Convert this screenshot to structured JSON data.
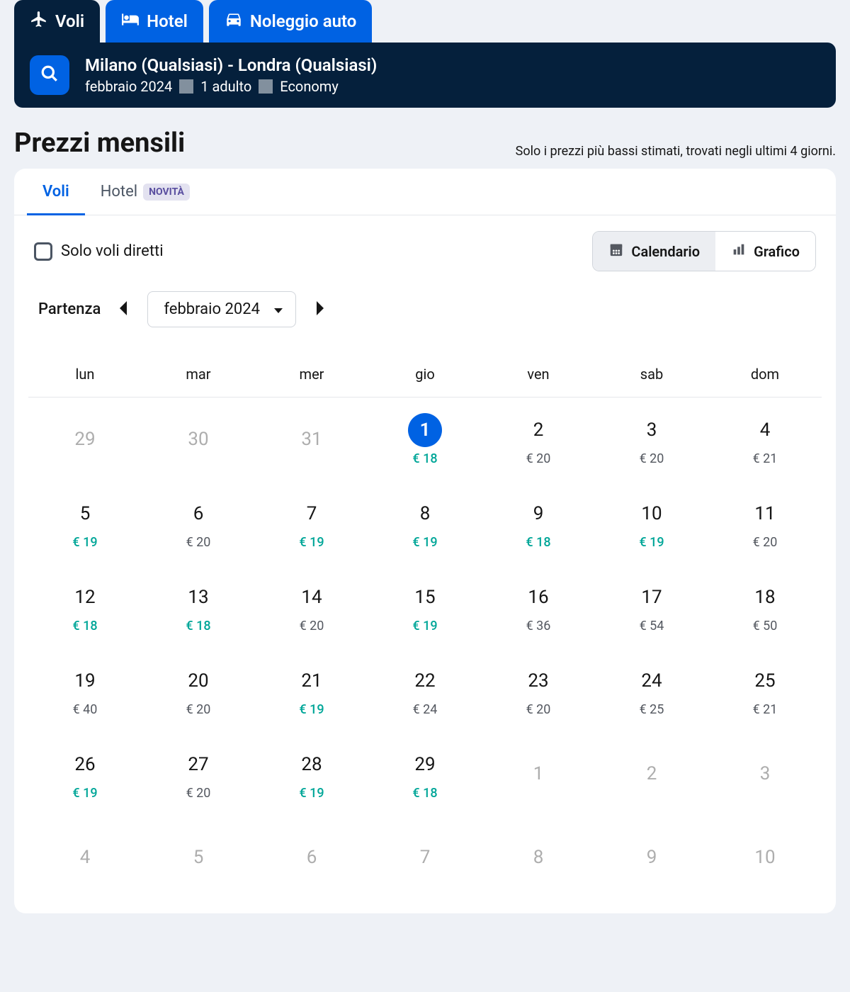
{
  "nav": {
    "flights": "Voli",
    "hotels": "Hotel",
    "cars": "Noleggio auto"
  },
  "search": {
    "route": "Milano (Qualsiasi) - Londra (Qualsiasi)",
    "month": "febbraio 2024",
    "pax": "1 adulto",
    "cabin": "Economy"
  },
  "header": {
    "title": "Prezzi mensili",
    "subtitle": "Solo i prezzi più bassi stimati, trovati negli ultimi 4 giorni."
  },
  "innerTabs": {
    "flights": "Voli",
    "hotels": "Hotel",
    "badge": "NOVITÀ"
  },
  "controls": {
    "directOnly": "Solo voli diretti",
    "calendar": "Calendario",
    "chart": "Grafico",
    "departure": "Partenza",
    "month": "febbraio 2024"
  },
  "weekdays": [
    "lun",
    "mar",
    "mer",
    "gio",
    "ven",
    "sab",
    "dom"
  ],
  "days": [
    {
      "d": "29",
      "out": true
    },
    {
      "d": "30",
      "out": true
    },
    {
      "d": "31",
      "out": true
    },
    {
      "d": "1",
      "p": "€ 18",
      "cheap": true,
      "selected": true
    },
    {
      "d": "2",
      "p": "€ 20"
    },
    {
      "d": "3",
      "p": "€ 20"
    },
    {
      "d": "4",
      "p": "€ 21"
    },
    {
      "d": "5",
      "p": "€ 19",
      "cheap": true
    },
    {
      "d": "6",
      "p": "€ 20"
    },
    {
      "d": "7",
      "p": "€ 19",
      "cheap": true
    },
    {
      "d": "8",
      "p": "€ 19",
      "cheap": true
    },
    {
      "d": "9",
      "p": "€ 18",
      "cheap": true
    },
    {
      "d": "10",
      "p": "€ 19",
      "cheap": true
    },
    {
      "d": "11",
      "p": "€ 20"
    },
    {
      "d": "12",
      "p": "€ 18",
      "cheap": true
    },
    {
      "d": "13",
      "p": "€ 18",
      "cheap": true
    },
    {
      "d": "14",
      "p": "€ 20"
    },
    {
      "d": "15",
      "p": "€ 19",
      "cheap": true
    },
    {
      "d": "16",
      "p": "€ 36"
    },
    {
      "d": "17",
      "p": "€ 54"
    },
    {
      "d": "18",
      "p": "€ 50"
    },
    {
      "d": "19",
      "p": "€ 40"
    },
    {
      "d": "20",
      "p": "€ 20"
    },
    {
      "d": "21",
      "p": "€ 19",
      "cheap": true
    },
    {
      "d": "22",
      "p": "€ 24"
    },
    {
      "d": "23",
      "p": "€ 20"
    },
    {
      "d": "24",
      "p": "€ 25"
    },
    {
      "d": "25",
      "p": "€ 21"
    },
    {
      "d": "26",
      "p": "€ 19",
      "cheap": true
    },
    {
      "d": "27",
      "p": "€ 20"
    },
    {
      "d": "28",
      "p": "€ 19",
      "cheap": true
    },
    {
      "d": "29",
      "p": "€ 18",
      "cheap": true
    },
    {
      "d": "1",
      "out": true
    },
    {
      "d": "2",
      "out": true
    },
    {
      "d": "3",
      "out": true
    },
    {
      "d": "4",
      "out": true
    },
    {
      "d": "5",
      "out": true
    },
    {
      "d": "6",
      "out": true
    },
    {
      "d": "7",
      "out": true
    },
    {
      "d": "8",
      "out": true
    },
    {
      "d": "9",
      "out": true
    },
    {
      "d": "10",
      "out": true
    }
  ]
}
